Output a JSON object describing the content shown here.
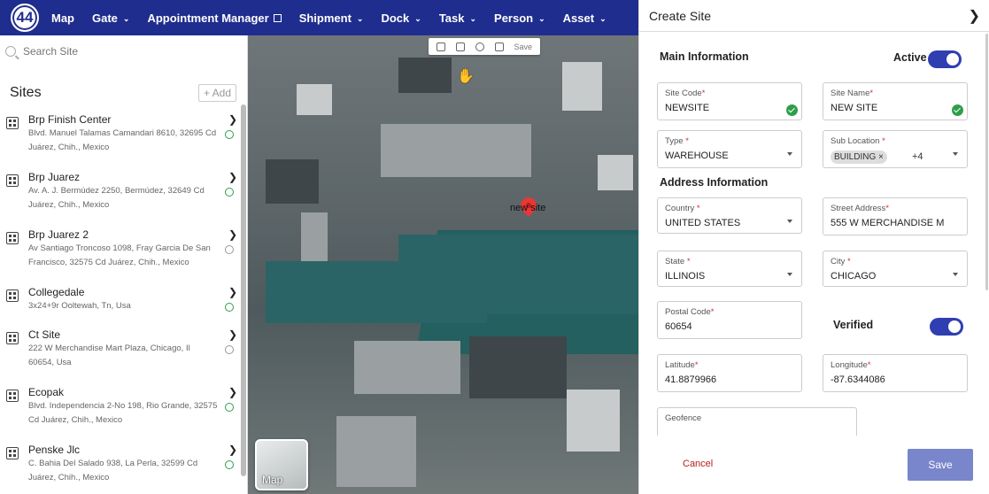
{
  "nav": {
    "logo": "44",
    "items": [
      {
        "label": "Map",
        "chevron": false,
        "external": false
      },
      {
        "label": "Gate",
        "chevron": true,
        "external": false
      },
      {
        "label": "Appointment Manager",
        "chevron": false,
        "external": true
      },
      {
        "label": "Shipment",
        "chevron": true,
        "external": false
      },
      {
        "label": "Dock",
        "chevron": true,
        "external": false
      },
      {
        "label": "Task",
        "chevron": true,
        "external": false
      },
      {
        "label": "Person",
        "chevron": true,
        "external": false
      },
      {
        "label": "Asset",
        "chevron": true,
        "external": false
      }
    ]
  },
  "sidebar": {
    "search_placeholder": "Search Site",
    "title": "Sites",
    "add_label": "+ Add",
    "sites": [
      {
        "name": "Brp Finish Center",
        "address": "Blvd. Manuel Talamas Camandari 8610, 32695 Cd Juárez, Chih., Mexico",
        "verified": true
      },
      {
        "name": "Brp Juarez",
        "address": "Av. A. J. Bermúdez 2250, Bermúdez, 32649 Cd Juárez, Chih., Mexico",
        "verified": true
      },
      {
        "name": "Brp Juarez 2",
        "address": "Av Santiago Troncoso 1098, Fray Garcia De San Francisco, 32575 Cd Juárez, Chih., Mexico",
        "verified": false
      },
      {
        "name": "Collegedale",
        "address": "3x24+9r Ooltewah, Tn, Usa",
        "verified": true
      },
      {
        "name": "Ct Site",
        "address": "222 W Merchandise Mart Plaza, Chicago, Il 60654, Usa",
        "verified": false
      },
      {
        "name": "Ecopak",
        "address": "Blvd. Independencia 2-No 198, Rio Grande, 32575 Cd Juárez, Chih., Mexico",
        "verified": true
      },
      {
        "name": "Penske Jlc",
        "address": "C. Bahia Del Salado 938, La Perla, 32599 Cd Juárez, Chih., Mexico",
        "verified": true
      }
    ]
  },
  "map": {
    "toolbar_save": "Save",
    "pin_label": "new site",
    "type_label": "Map"
  },
  "panel": {
    "title": "Create Site",
    "main_info": "Main Information",
    "active_label": "Active",
    "address_info": "Address Information",
    "verified_label": "Verified",
    "fields": {
      "site_code": {
        "label": "Site Code",
        "value": "NEWSITE"
      },
      "site_name": {
        "label": "Site Name",
        "value": "NEW SITE"
      },
      "type": {
        "label": "Type",
        "value": "WAREHOUSE"
      },
      "sub_location": {
        "label": "Sub Location",
        "chip": "BUILDING",
        "more": "+4"
      },
      "country": {
        "label": "Country",
        "value": "UNITED STATES"
      },
      "street": {
        "label": "Street Address",
        "value": "555 W MERCHANDISE M"
      },
      "state": {
        "label": "State",
        "value": "ILLINOIS"
      },
      "city": {
        "label": "City",
        "value": "CHICAGO"
      },
      "postal": {
        "label": "Postal Code",
        "value": "60654"
      },
      "latitude": {
        "label": "Latitude",
        "value": "41.8879966"
      },
      "longitude": {
        "label": "Longitude",
        "value": "-87.6344086"
      },
      "geofence": {
        "label": "Geofence"
      }
    },
    "cancel_label": "Cancel",
    "save_label": "Save"
  },
  "colors": {
    "nav_bg": "#1f2d8e",
    "toggle_on": "#2f3eb1",
    "save_btn": "#7986cb",
    "required": "#d32f2f",
    "verified_green": "#2e9e4a"
  }
}
